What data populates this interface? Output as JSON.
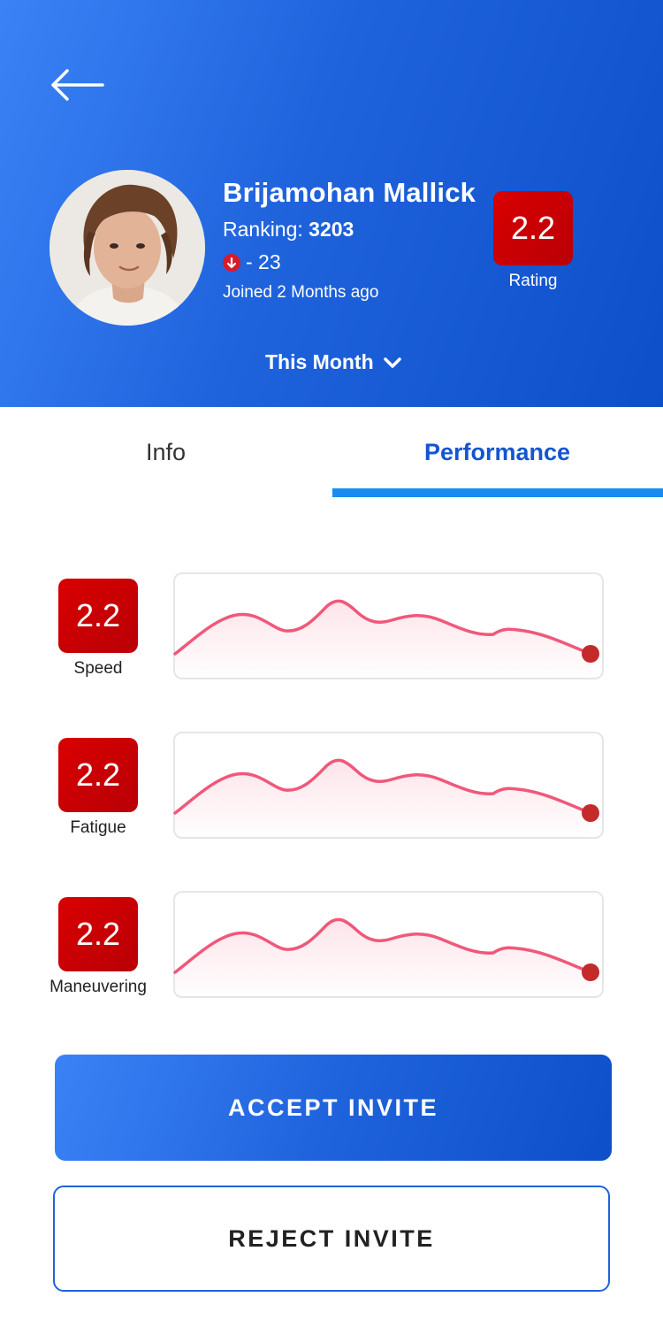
{
  "profile": {
    "name": "Brijamohan Mallick",
    "ranking_label": "Ranking: ",
    "ranking_value": "3203",
    "delta": "- 23",
    "joined": "Joined 2 Months ago",
    "rating_value": "2.2",
    "rating_label": "Rating",
    "period": "This Month"
  },
  "tabs": [
    {
      "label": "Info",
      "active": false
    },
    {
      "label": "Performance",
      "active": true
    }
  ],
  "metrics": [
    {
      "value": "2.2",
      "label": "Speed"
    },
    {
      "value": "2.2",
      "label": "Fatigue"
    },
    {
      "value": "2.2",
      "label": "Maneuvering"
    }
  ],
  "actions": {
    "accept": "ACCEPT INVITE",
    "reject": "REJECT INVITE"
  },
  "colors": {
    "brand_blue": "#1f63dc",
    "accent_blue": "#1a8cf0",
    "rating_red": "#c80004",
    "spark_line": "#f0587a"
  }
}
